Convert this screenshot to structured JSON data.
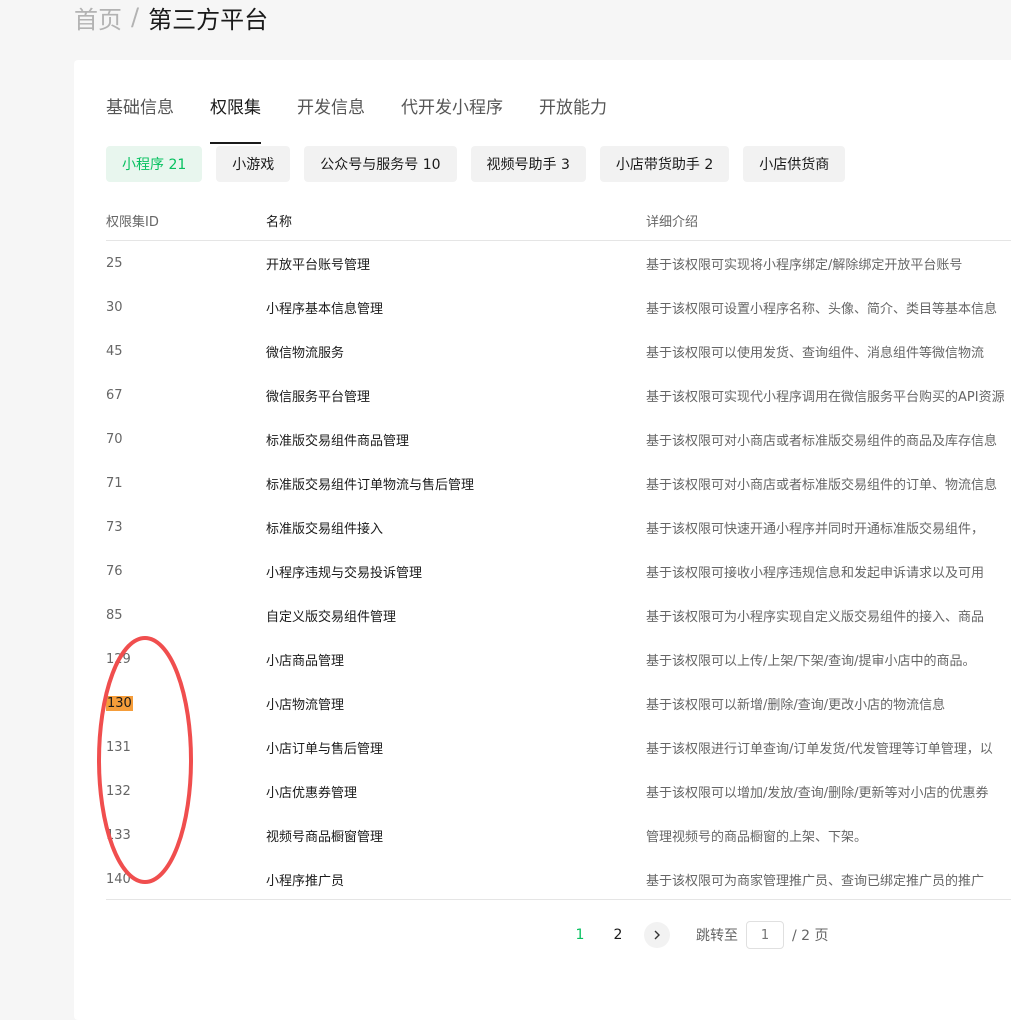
{
  "breadcrumb": {
    "home": "首页",
    "separator": "/",
    "current": "第三方平台"
  },
  "tabs": [
    {
      "label": "基础信息",
      "active": false
    },
    {
      "label": "权限集",
      "active": true
    },
    {
      "label": "开发信息",
      "active": false
    },
    {
      "label": "代开发小程序",
      "active": false
    },
    {
      "label": "开放能力",
      "active": false
    }
  ],
  "chips": [
    {
      "label": "小程序 21",
      "active": true
    },
    {
      "label": "小游戏",
      "active": false
    },
    {
      "label": "公众号与服务号 10",
      "active": false
    },
    {
      "label": "视频号助手 3",
      "active": false
    },
    {
      "label": "小店带货助手 2",
      "active": false
    },
    {
      "label": "小店供货商",
      "active": false
    }
  ],
  "table": {
    "headers": {
      "id": "权限集ID",
      "name": "名称",
      "desc": "详细介绍"
    },
    "rows": [
      {
        "id": "25",
        "name": "开放平台账号管理",
        "desc": "基于该权限可实现将小程序绑定/解除绑定开放平台账号"
      },
      {
        "id": "30",
        "name": "小程序基本信息管理",
        "desc": "基于该权限可设置小程序名称、头像、简介、类目等基本信息"
      },
      {
        "id": "45",
        "name": "微信物流服务",
        "desc": "基于该权限可以使用发货、查询组件、消息组件等微信物流"
      },
      {
        "id": "67",
        "name": "微信服务平台管理",
        "desc": "基于该权限可实现代小程序调用在微信服务平台购买的API资源"
      },
      {
        "id": "70",
        "name": "标准版交易组件商品管理",
        "desc": "基于该权限可对小商店或者标准版交易组件的商品及库存信息"
      },
      {
        "id": "71",
        "name": "标准版交易组件订单物流与售后管理",
        "desc": "基于该权限可对小商店或者标准版交易组件的订单、物流信息"
      },
      {
        "id": "73",
        "name": "标准版交易组件接入",
        "desc": "基于该权限可快速开通小程序并同时开通标准版交易组件，"
      },
      {
        "id": "76",
        "name": "小程序违规与交易投诉管理",
        "desc": "基于该权限可接收小程序违规信息和发起申诉请求以及可用"
      },
      {
        "id": "85",
        "name": "自定义版交易组件管理",
        "desc": "基于该权限可为小程序实现自定义版交易组件的接入、商品"
      },
      {
        "id": "129",
        "name": "小店商品管理",
        "desc": "基于该权限可以上传/上架/下架/查询/提审小店中的商品。"
      },
      {
        "id": "130",
        "name": "小店物流管理",
        "desc": "基于该权限可以新增/删除/查询/更改小店的物流信息",
        "highlight": true
      },
      {
        "id": "131",
        "name": "小店订单与售后管理",
        "desc": "基于该权限进行订单查询/订单发货/代发管理等订单管理，以"
      },
      {
        "id": "132",
        "name": "小店优惠券管理",
        "desc": "基于该权限可以增加/发放/查询/删除/更新等对小店的优惠券"
      },
      {
        "id": "133",
        "name": "视频号商品橱窗管理",
        "desc": "管理视频号的商品橱窗的上架、下架。"
      },
      {
        "id": "140",
        "name": "小程序推广员",
        "desc": "基于该权限可为商家管理推广员、查询已绑定推广员的推广"
      }
    ]
  },
  "pagination": {
    "pages": [
      "1",
      "2"
    ],
    "current": "1",
    "next_icon": "chevron-right-icon",
    "jump_label": "跳转至",
    "jump_placeholder": "1",
    "total": "/ 2 页"
  },
  "colors": {
    "accent": "#07c160",
    "highlight": "#f59d3a",
    "annotation": "#f04e4e"
  }
}
